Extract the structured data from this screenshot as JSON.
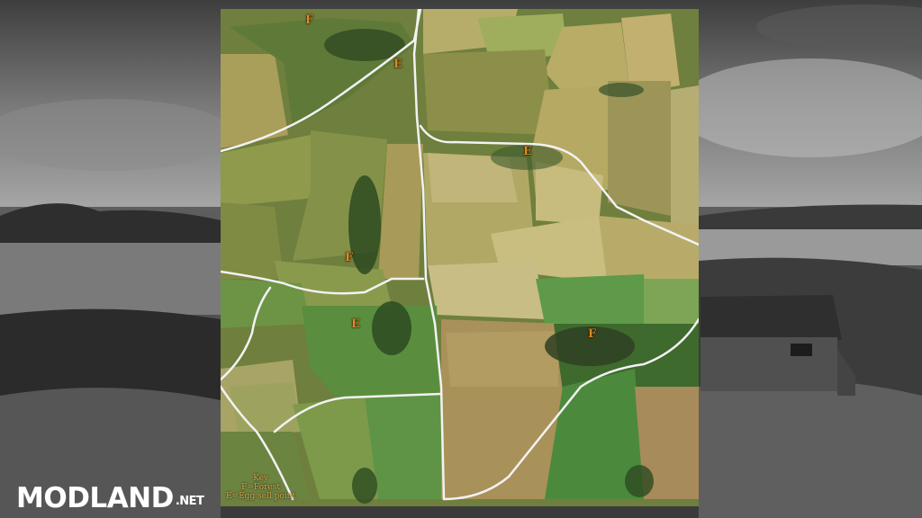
{
  "map": {
    "key": {
      "title": "Key",
      "forest": "F=Forest",
      "egg": "E=Egg sell point"
    },
    "markers": [
      {
        "id": "forest-1",
        "label": "F",
        "type": "forest"
      },
      {
        "id": "egg-1",
        "label": "E",
        "type": "egg"
      },
      {
        "id": "egg-2",
        "label": "E",
        "type": "egg"
      },
      {
        "id": "forest-2",
        "label": "F",
        "type": "forest"
      },
      {
        "id": "egg-3",
        "label": "E",
        "type": "egg"
      },
      {
        "id": "forest-3",
        "label": "F",
        "type": "forest"
      }
    ],
    "colors": {
      "marker": "#e08a1e",
      "key_text": "#d9a44a",
      "road": "#f2f2f2"
    }
  },
  "watermark": {
    "brand": "MODLAND",
    "tld": ".NET"
  }
}
